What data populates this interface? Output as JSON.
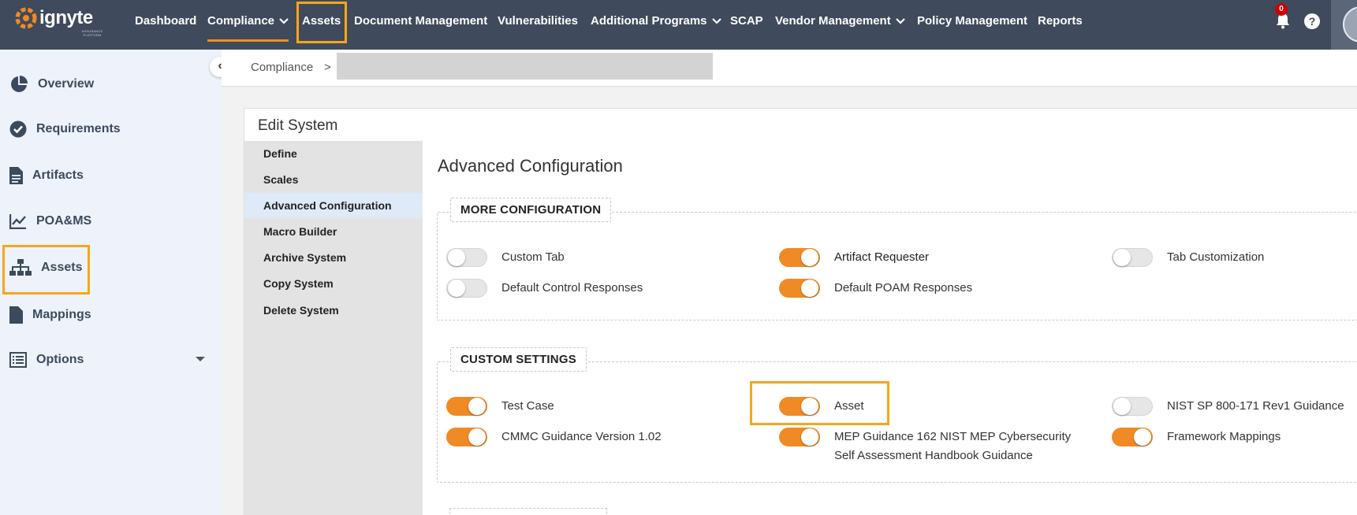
{
  "brand": {
    "name": "ignyte",
    "tagline": "ASSURANCE PLATFORM"
  },
  "topnav": {
    "items": [
      {
        "label": "Dashboard"
      },
      {
        "label": "Compliance"
      },
      {
        "label": "Assets"
      },
      {
        "label": "Document Management"
      },
      {
        "label": "Vulnerabilities"
      },
      {
        "label": "Additional Programs"
      },
      {
        "label": "SCAP"
      },
      {
        "label": "Vendor Management"
      },
      {
        "label": "Policy Management"
      },
      {
        "label": "Reports"
      }
    ],
    "notification_count": "0",
    "help_label": "?"
  },
  "sidebar": {
    "items": [
      {
        "label": "Overview",
        "icon": "pie-chart-icon"
      },
      {
        "label": "Requirements",
        "icon": "check-circle-icon"
      },
      {
        "label": "Artifacts",
        "icon": "document-icon"
      },
      {
        "label": "POA&MS",
        "icon": "line-chart-icon"
      },
      {
        "label": "Assets",
        "icon": "sitemap-icon"
      },
      {
        "label": "Mappings",
        "icon": "file-icon"
      },
      {
        "label": "Options",
        "icon": "list-icon"
      }
    ],
    "collapse_label": "‹"
  },
  "breadcrumb": {
    "root": "Compliance",
    "separator": ">"
  },
  "panel": {
    "title": "Edit System",
    "subnav": [
      {
        "label": "Define"
      },
      {
        "label": "Scales"
      },
      {
        "label": "Advanced Configuration",
        "active": true
      },
      {
        "label": "Macro Builder"
      },
      {
        "label": "Archive System"
      },
      {
        "label": "Copy System"
      },
      {
        "label": "Delete System"
      }
    ],
    "section_heading": "Advanced Configuration",
    "more_configuration": {
      "legend": "MORE CONFIGURATION",
      "toggles": [
        {
          "label": "Custom Tab",
          "on": false
        },
        {
          "label": "Artifact Requester",
          "on": true
        },
        {
          "label": "Tab Customization",
          "on": false
        },
        {
          "label": "Default Control Responses",
          "on": false
        },
        {
          "label": "Default POAM Responses",
          "on": true
        }
      ]
    },
    "custom_settings": {
      "legend": "CUSTOM SETTINGS",
      "toggles": [
        {
          "label": "Test Case",
          "on": true
        },
        {
          "label": "Asset",
          "on": true
        },
        {
          "label": "NIST SP 800-171 Rev1 Guidance",
          "on": false
        },
        {
          "label": "CMMC Guidance Version 1.02",
          "on": true
        },
        {
          "label": "MEP Guidance 162 NIST MEP Cybersecurity Self Assessment Handbook Guidance",
          "on": true
        },
        {
          "label": "Framework Mappings",
          "on": true
        }
      ]
    }
  },
  "colors": {
    "nav_bg": "#3f4a5c",
    "accent": "#f08a24",
    "highlight": "#f7a61b",
    "sidebar_bg": "#eef3fb"
  }
}
